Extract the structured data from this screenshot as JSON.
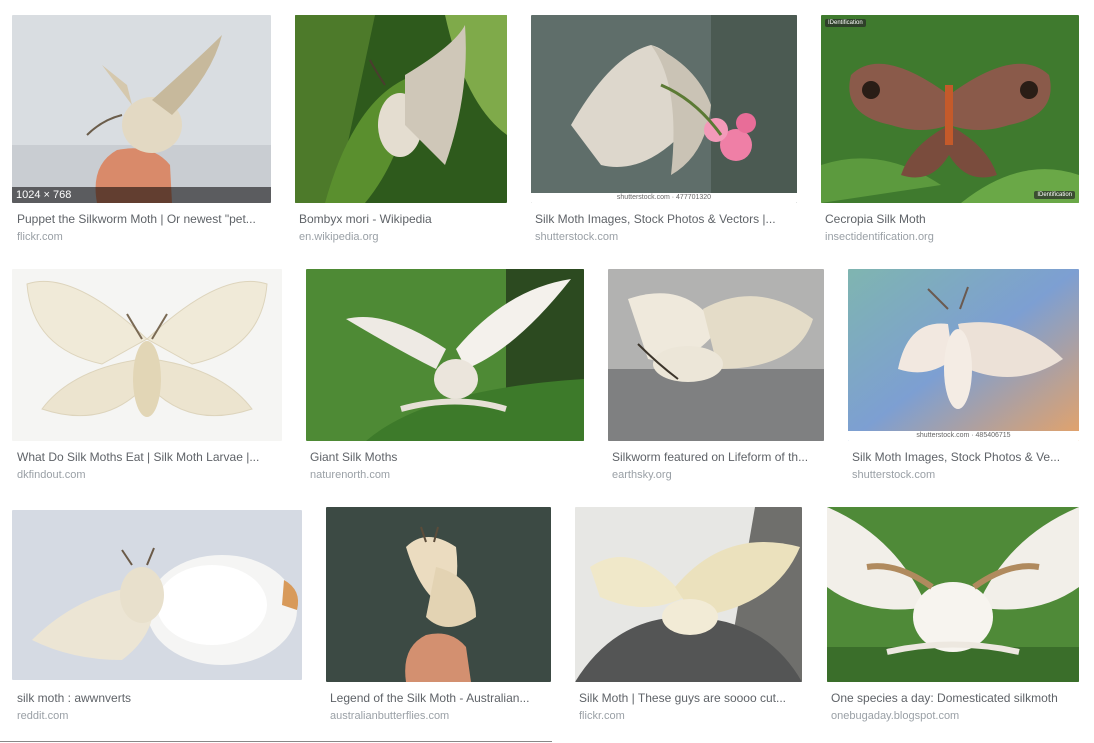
{
  "results": [
    {
      "title": "Puppet the Silkworm Moth | Or newest \"pet...",
      "source": "flickr.com",
      "dims": "1024 × 768",
      "icon": "moth-on-finger-image"
    },
    {
      "title": "Bombyx mori - Wikipedia",
      "source": "en.wikipedia.org",
      "icon": "moth-on-leaf-image"
    },
    {
      "title": "Silk Moth Images, Stock Photos & Vectors |...",
      "source": "shutterstock.com",
      "watermark": "shutterstock.com · 477701320",
      "icon": "moth-with-flower-image"
    },
    {
      "title": "Cecropia Silk Moth",
      "source": "insectidentification.org",
      "icon": "cecropia-moth-image"
    },
    {
      "title": "What Do Silk Moths Eat | Silk Moth Larvae |...",
      "source": "dkfindout.com",
      "icon": "spread-moth-image"
    },
    {
      "title": "Giant Silk Moths",
      "source": "naturenorth.com",
      "icon": "moth-wings-up-image"
    },
    {
      "title": "Silkworm featured on Lifeform of th...",
      "source": "earthsky.org",
      "icon": "moth-on-gray-image"
    },
    {
      "title": "Silk Moth Images, Stock Photos & Ve...",
      "source": "shutterstock.com",
      "watermark": "shutterstock.com · 485406715",
      "icon": "moth-blurred-bg-image"
    },
    {
      "title": "silk moth : awwnverts",
      "source": "reddit.com",
      "icon": "moth-with-cocoon-image"
    },
    {
      "title": "Legend of the Silk Moth - Australian...",
      "source": "australianbutterflies.com",
      "icon": "moth-on-finger-dark-image"
    },
    {
      "title": "Silk Moth | These guys are soooo cut...",
      "source": "flickr.com",
      "icon": "moth-on-rock-image"
    },
    {
      "title": "One species a day: Domesticated silkmoth",
      "source": "onebugaday.blogspot.com",
      "icon": "moth-closeup-image"
    }
  ]
}
